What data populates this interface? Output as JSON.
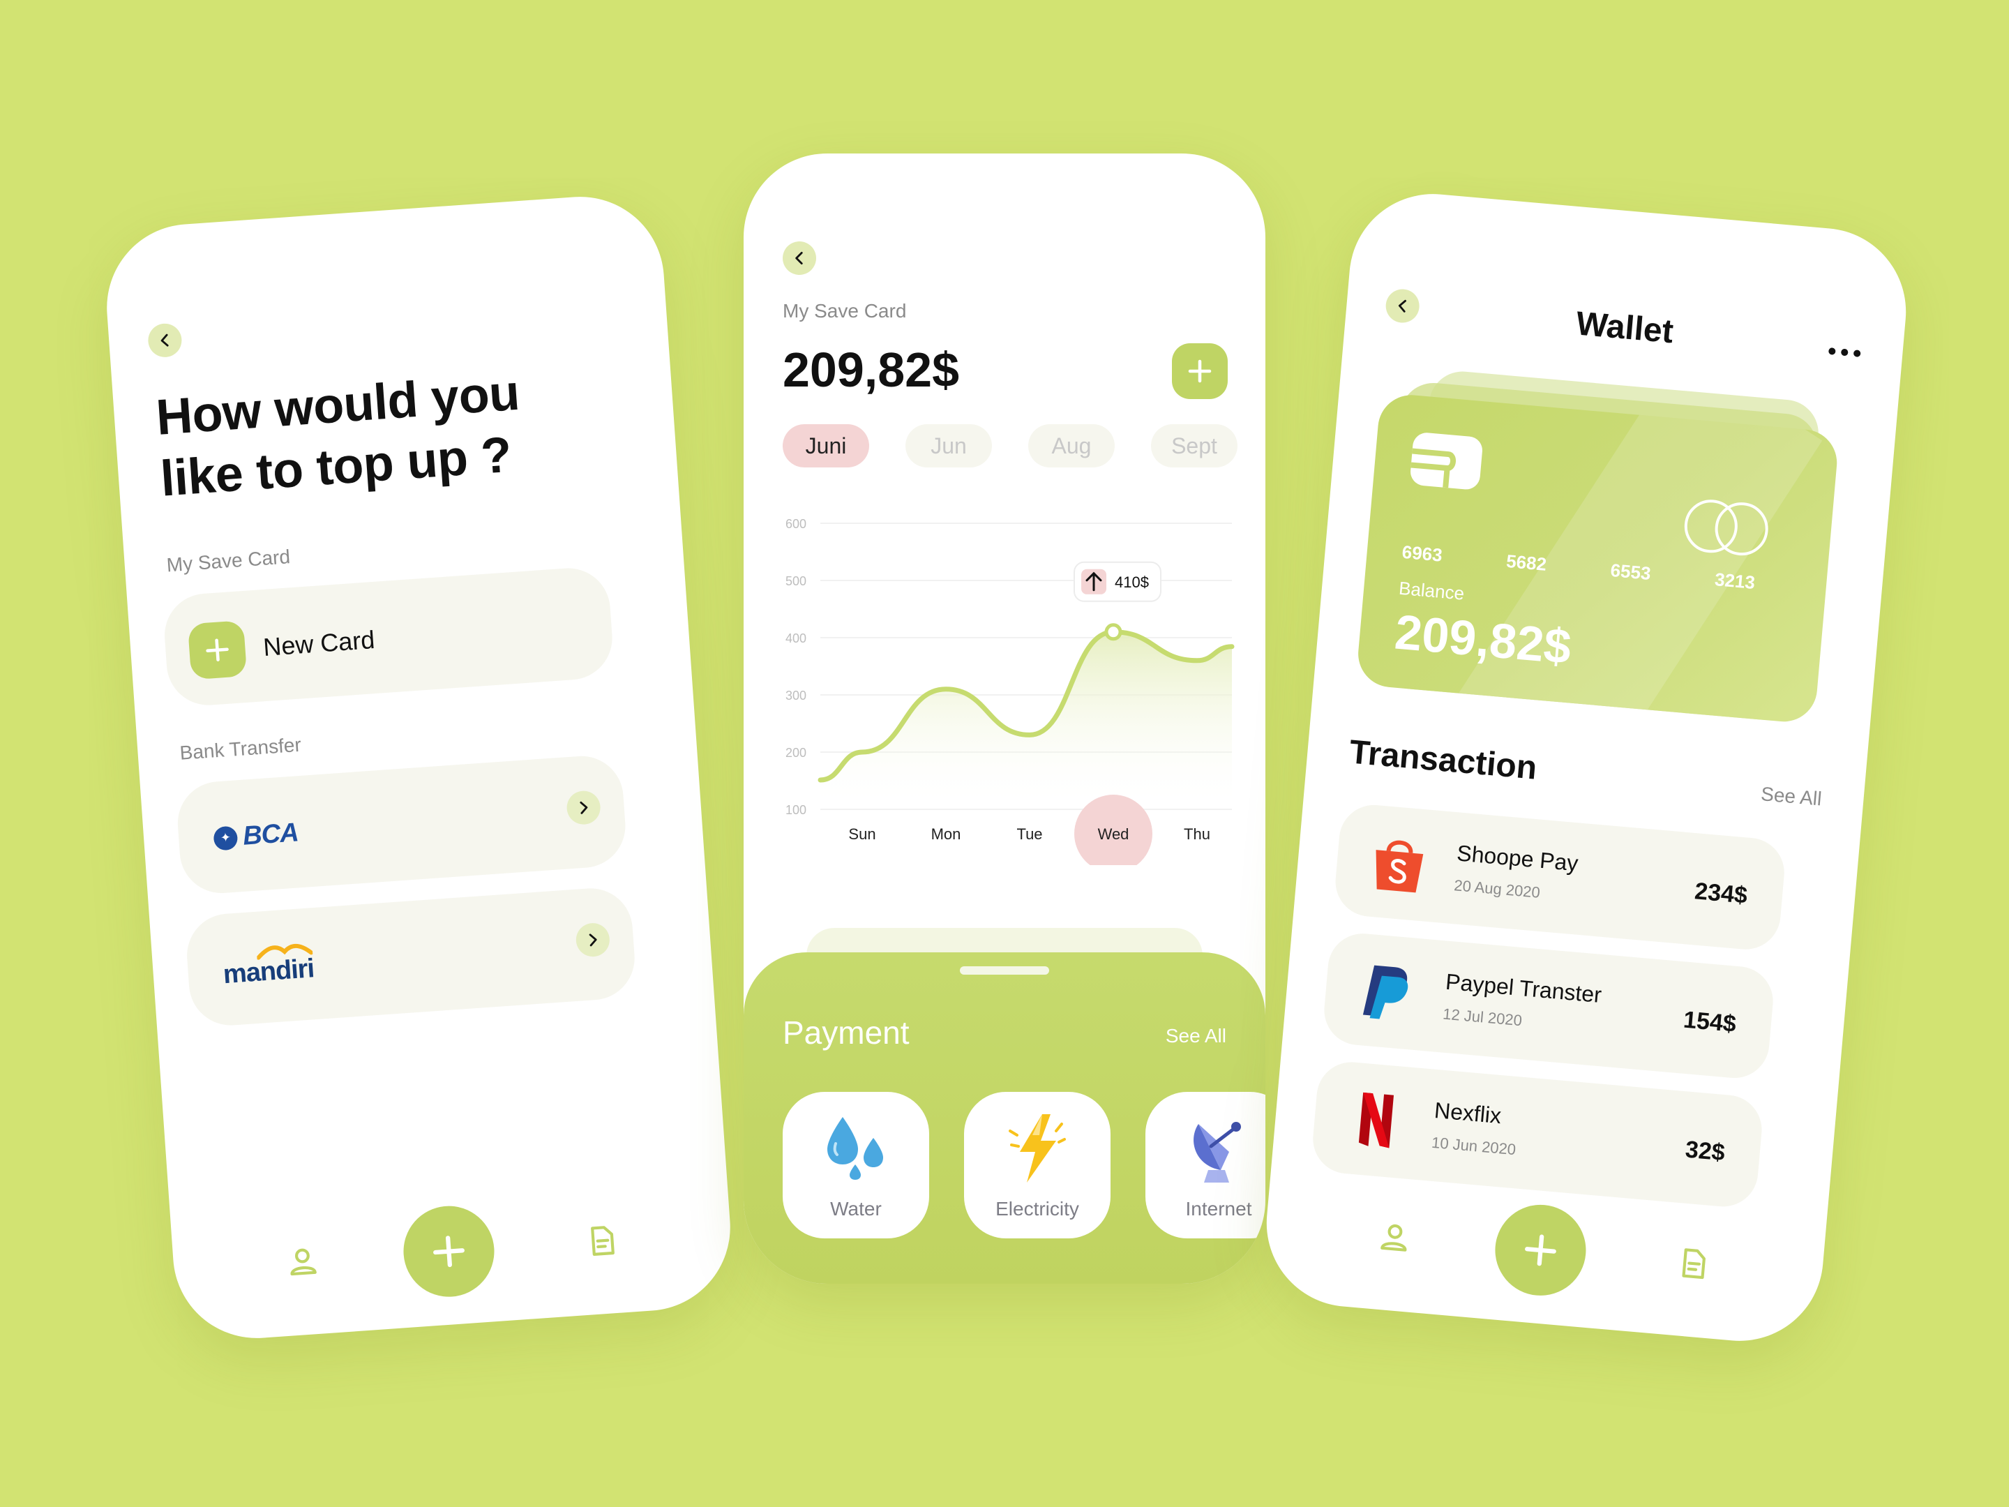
{
  "colors": {
    "background": "#d2e372",
    "accent": "#bfd464",
    "accent_light": "#e2ebb4",
    "active_tab": "#f4d4d4",
    "card_surface": "#f6f6ee"
  },
  "top_up": {
    "title_line1": "How would you",
    "title_line2": "like to top  up ?",
    "save_card_label": "My Save Card",
    "new_card_label": "New Card",
    "bank_transfer_label": "Bank Transfer",
    "banks": [
      {
        "name": "BCA",
        "icon": "bca-logo"
      },
      {
        "name": "mandiri",
        "icon": "mandiri-logo"
      }
    ]
  },
  "save_card": {
    "label": "My Save Card",
    "balance": "209,82$",
    "months": [
      "Juni",
      "Jun",
      "Aug",
      "Sept"
    ],
    "active_month": "Juni",
    "payment": {
      "title": "Payment",
      "see_all": "See All",
      "items": [
        {
          "label": "Water",
          "icon": "water-drops-icon"
        },
        {
          "label": "Electricity",
          "icon": "lightning-icon"
        },
        {
          "label": "Internet",
          "icon": "satellite-dish-icon"
        }
      ]
    }
  },
  "chart_data": {
    "type": "line",
    "title": "",
    "xlabel": "",
    "ylabel": "",
    "categories": [
      "Sun",
      "Mon",
      "Tue",
      "Wed",
      "Thu"
    ],
    "x": [
      "Sun",
      "Mon",
      "Tue",
      "Wed",
      "Thu"
    ],
    "yticks": [
      600,
      500,
      400,
      300,
      200,
      100
    ],
    "ylim": [
      100,
      600
    ],
    "values": [
      200,
      310,
      230,
      410,
      360
    ],
    "highlight": {
      "category": "Wed",
      "label": "410$"
    },
    "grid": true,
    "color": "#c6db6f"
  },
  "wallet": {
    "title": "Wallet",
    "card": {
      "numbers": [
        "6963",
        "5682",
        "6553",
        "3213"
      ],
      "balance_label": "Balance",
      "balance": "209,82$"
    },
    "transaction_title": "Transaction",
    "see_all": "See All",
    "transactions": [
      {
        "name": "Shoope Pay",
        "date": "20 Aug 2020",
        "amount": "234$",
        "icon": "shopping-bag-icon"
      },
      {
        "name": "Paypel Transter",
        "date": "12 Jul 2020",
        "amount": "154$",
        "icon": "paypal-icon"
      },
      {
        "name": "Nexflix",
        "date": "10 Jun 2020",
        "amount": "32$",
        "icon": "netflix-icon"
      }
    ]
  },
  "nav": {
    "items": [
      "user-icon",
      "plus-icon",
      "document-icon"
    ]
  }
}
